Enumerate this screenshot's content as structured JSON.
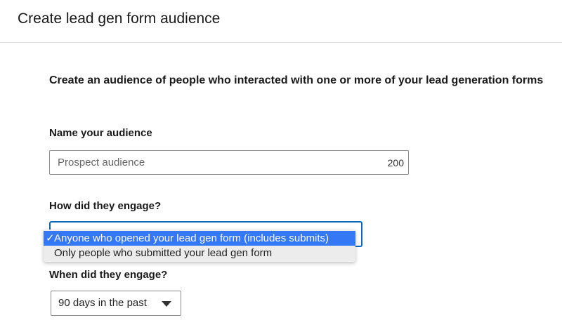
{
  "header": {
    "title": "Create lead gen form audience"
  },
  "intro": {
    "text": "Create an audience of people who interacted with one or more of your lead generation forms"
  },
  "name_section": {
    "label": "Name your audience",
    "placeholder": "Prospect audience",
    "char_limit": "200"
  },
  "engage_section": {
    "label": "How did they engage?",
    "options": [
      {
        "check": "✓",
        "label": "Anyone who opened your lead gen form (includes submits)",
        "selected": true
      },
      {
        "label": "Only people who submitted your lead gen form",
        "selected": false
      }
    ]
  },
  "timeframe_section": {
    "label": "When did they engage?",
    "selected_value": "90 days in the past",
    "icon": "caret-down-icon"
  },
  "colors": {
    "focus_border": "#0a66c2",
    "option_highlight": "#3478f6",
    "dropdown_bg": "#ececec"
  }
}
